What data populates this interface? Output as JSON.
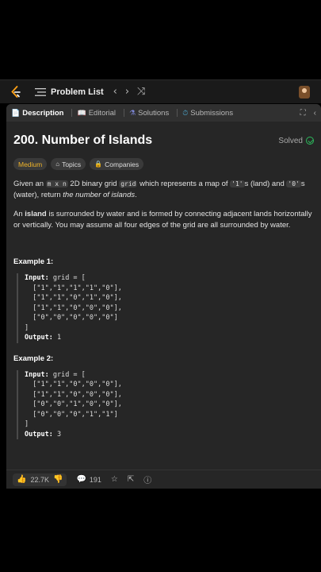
{
  "topbar": {
    "problem_list_label": "Problem List",
    "prev_glyph": "‹",
    "next_glyph": "›",
    "shuffle_glyph": "⤨",
    "icons": [
      "leetcode-logo-icon",
      "list-icon",
      "shuffle-icon",
      "avatar"
    ]
  },
  "tabs": [
    {
      "label": "Description",
      "icon": "📄",
      "active": true
    },
    {
      "label": "Editorial",
      "icon": "📖",
      "active": false
    },
    {
      "label": "Solutions",
      "icon": "⚗",
      "active": false
    },
    {
      "label": "Submissions",
      "icon": "⏱",
      "active": false
    }
  ],
  "tab_tools": {
    "expand": "⛶",
    "collapse": "‹"
  },
  "problem": {
    "title": "200. Number of Islands",
    "status": "Solved",
    "difficulty": "Medium",
    "topics_label": "Topics",
    "companies_label": "Companies",
    "desc1_a": "Given an ",
    "desc1_code1": "m x n",
    "desc1_b": " 2D binary grid ",
    "desc1_code2": "grid",
    "desc1_c": " which represents a map of ",
    "desc1_code3": "'1'",
    "desc1_d": "s (land) and ",
    "desc1_code4": "'0'",
    "desc1_e": "s (water), return ",
    "desc1_em": "the number of islands",
    "desc1_f": ".",
    "desc2_a": "An ",
    "desc2_bold": "island",
    "desc2_b": " is surrounded by water and is formed by connecting adjacent lands horizontally or vertically. You may assume all four edges of the grid are all surrounded by water."
  },
  "examples": [
    {
      "title": "Example 1:",
      "input_label": "Input:",
      "input_head": " grid = [",
      "rows": [
        "  [\"1\",\"1\",\"1\",\"1\",\"0\"],",
        "  [\"1\",\"1\",\"0\",\"1\",\"0\"],",
        "  [\"1\",\"1\",\"0\",\"0\",\"0\"],",
        "  [\"0\",\"0\",\"0\",\"0\",\"0\"]"
      ],
      "close": "]",
      "output_label": "Output:",
      "output_value": " 1"
    },
    {
      "title": "Example 2:",
      "input_label": "Input:",
      "input_head": " grid = [",
      "rows": [
        "  [\"1\",\"1\",\"0\",\"0\",\"0\"],",
        "  [\"1\",\"1\",\"0\",\"0\",\"0\"],",
        "  [\"0\",\"0\",\"1\",\"0\",\"0\"],",
        "  [\"0\",\"0\",\"0\",\"1\",\"1\"]"
      ],
      "close": "]",
      "output_label": "Output:",
      "output_value": " 3"
    }
  ],
  "bottom": {
    "likes": "22.7K",
    "comments": "191",
    "icons": [
      "thumbs-up-icon",
      "thumbs-down-icon",
      "comment-icon",
      "star-icon",
      "share-icon",
      "help-icon"
    ]
  }
}
